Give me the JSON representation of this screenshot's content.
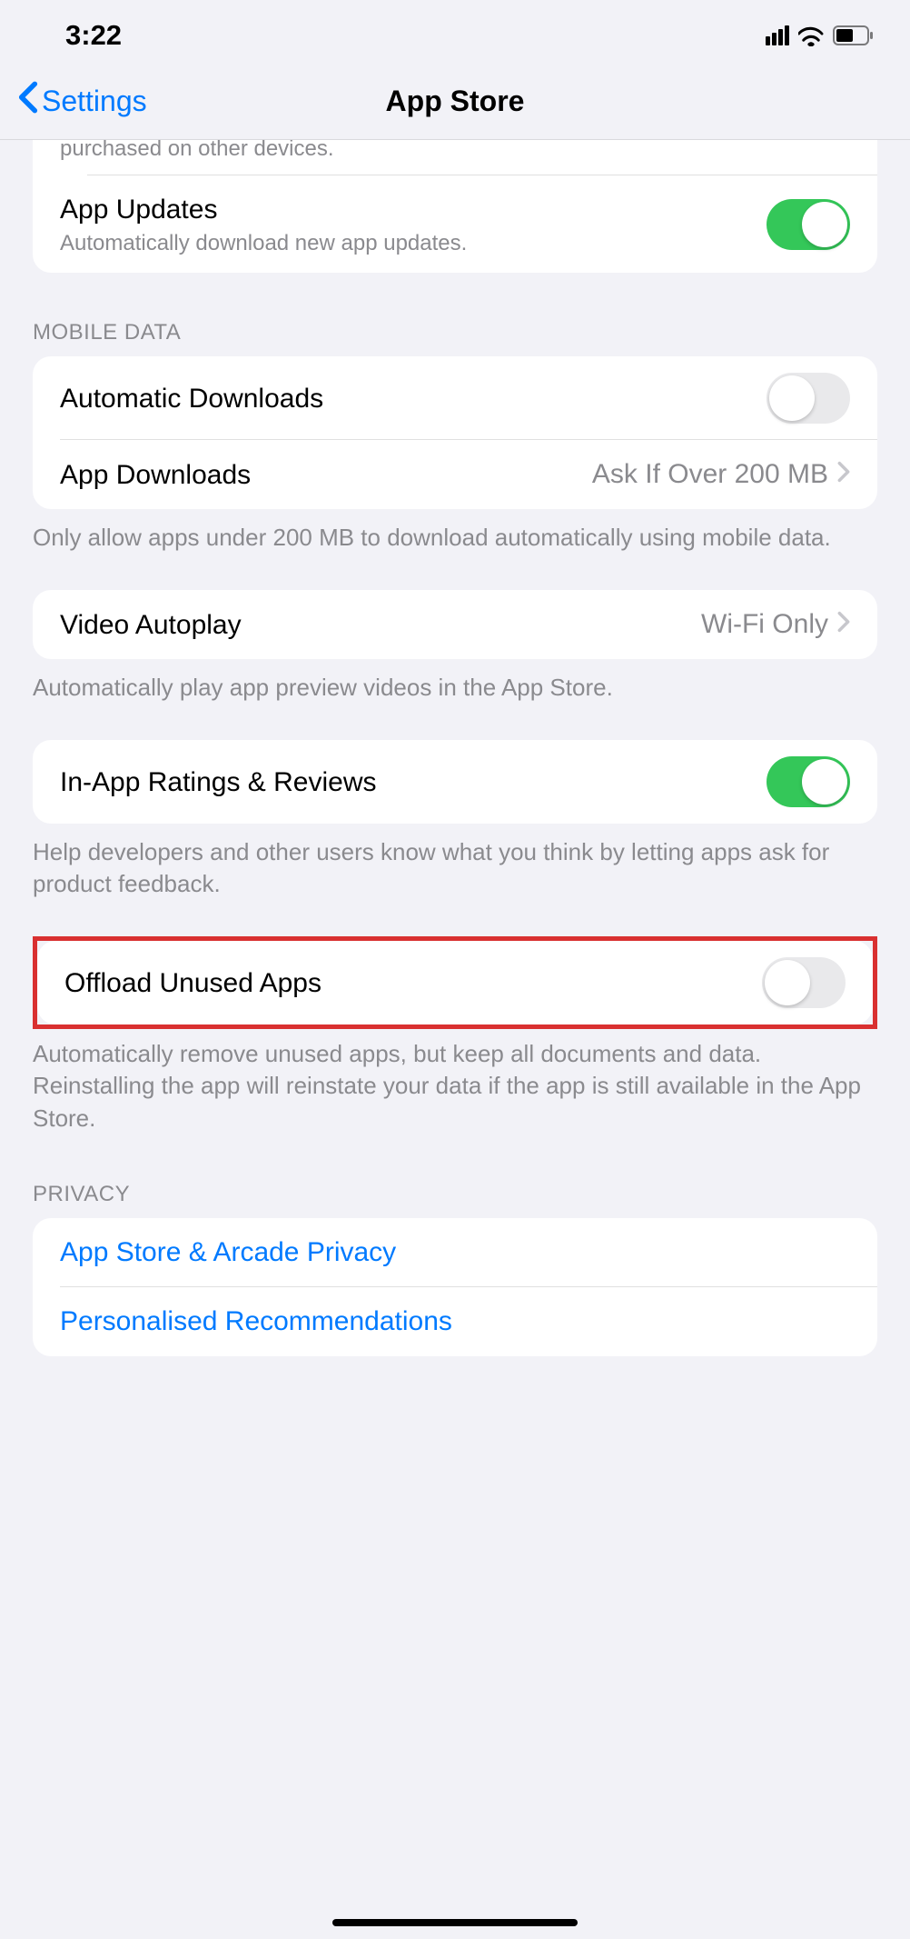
{
  "status": {
    "time": "3:22"
  },
  "nav": {
    "back_label": "Settings",
    "title": "App Store"
  },
  "partial_top": {
    "subtitle": "purchased on other devices.",
    "app_updates_title": "App Updates",
    "app_updates_subtitle": "Automatically download new app updates."
  },
  "mobile_data": {
    "header": "MOBILE DATA",
    "auto_downloads_title": "Automatic Downloads",
    "app_downloads_title": "App Downloads",
    "app_downloads_value": "Ask If Over 200 MB",
    "footer": "Only allow apps under 200 MB to download automatically using mobile data."
  },
  "video": {
    "title": "Video Autoplay",
    "value": "Wi-Fi Only",
    "footer": "Automatically play app preview videos in the App Store."
  },
  "ratings": {
    "title": "In-App Ratings & Reviews",
    "footer": "Help developers and other users know what you think by letting apps ask for product feedback."
  },
  "offload": {
    "title": "Offload Unused Apps",
    "footer": "Automatically remove unused apps, but keep all documents and data. Reinstalling the app will reinstate your data if the app is still available in the App Store."
  },
  "privacy": {
    "header": "PRIVACY",
    "item1": "App Store & Arcade Privacy",
    "item2": "Personalised Recommendations"
  }
}
